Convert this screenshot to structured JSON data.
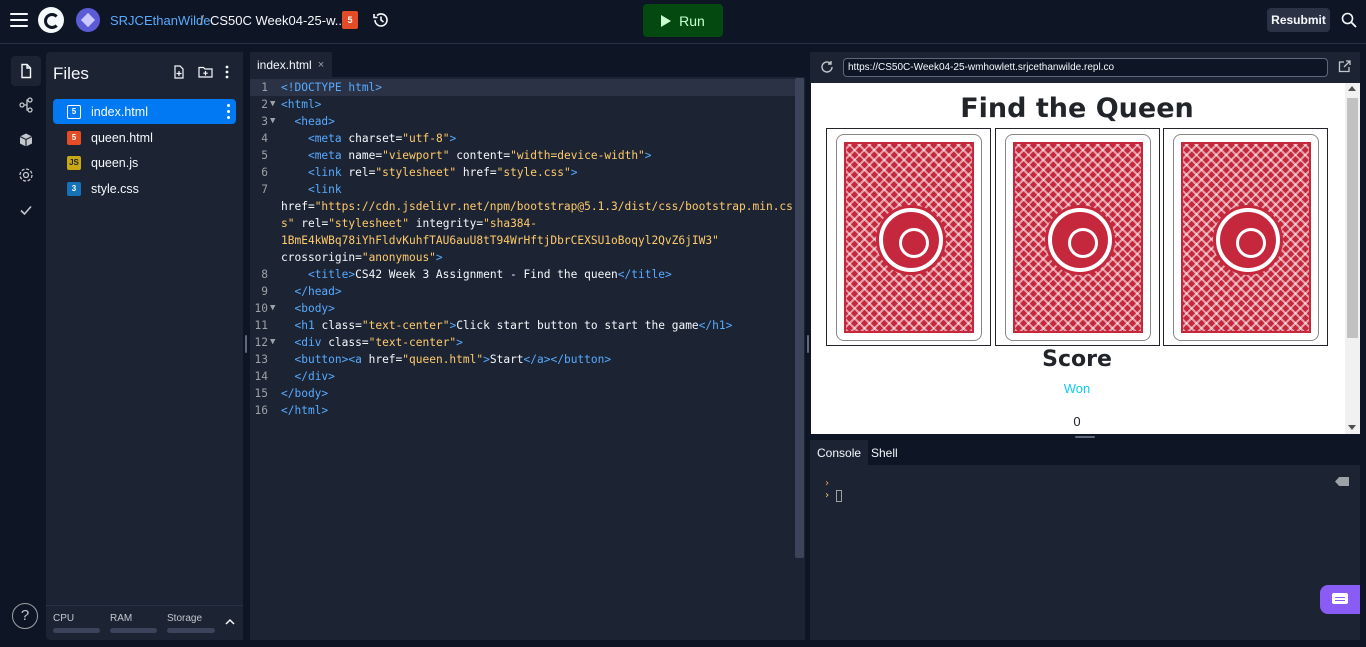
{
  "topbar": {
    "owner": "SRJCEthanWilde",
    "separator": "/",
    "repl_name": "CS50C Week04-25-w...",
    "run_label": "Run",
    "resubmit_label": "Resubmit"
  },
  "files": {
    "title": "Files",
    "items": [
      {
        "name": "index.html",
        "type": "html",
        "active": true
      },
      {
        "name": "queen.html",
        "type": "html5"
      },
      {
        "name": "queen.js",
        "type": "js"
      },
      {
        "name": "style.css",
        "type": "css"
      }
    ],
    "resources": {
      "cpu": "CPU",
      "ram": "RAM",
      "storage": "Storage"
    }
  },
  "editor": {
    "tab_label": "index.html",
    "tab_close": "×",
    "line_numbers": [
      "1",
      "2",
      "3",
      "4",
      "5",
      "6",
      "7",
      "8",
      "9",
      "10",
      "11",
      "12",
      "13",
      "14",
      "15",
      "16"
    ]
  },
  "webview": {
    "url": "https://CS50C-Week04-25-wmhowlett.srjcethanwilde.repl.co",
    "page_title": "Find the Queen",
    "score_heading": "Score",
    "won_label": "Won",
    "score_value": "0"
  },
  "console": {
    "tabs": [
      "Console",
      "Shell"
    ],
    "prompt_symbol": "›"
  },
  "colors": {
    "background": "#0e1525",
    "panel": "#1c2333",
    "accent": "#0079f2",
    "run_green": "#044a10",
    "card_red": "#c5283d"
  }
}
